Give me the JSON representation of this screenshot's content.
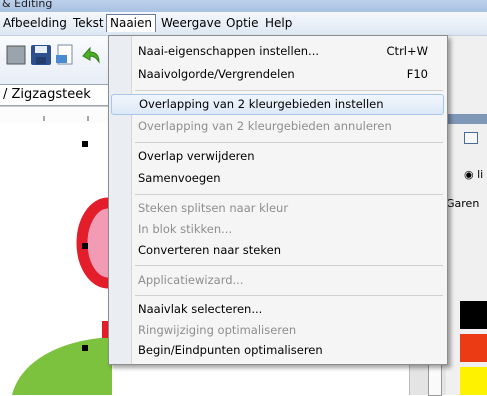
{
  "window": {
    "title": "& Editing"
  },
  "menubar": {
    "items": [
      "Afbeelding",
      "Tekst",
      "Naaien",
      "Weergave",
      "Optie",
      "Help"
    ],
    "active": "Naaien"
  },
  "stitch_type": {
    "value": "Zigzagsteek",
    "prefix": "/"
  },
  "right_panel": {
    "radio_text": "li",
    "label": "Garen"
  },
  "dropdown": {
    "items": [
      {
        "label": "Naai-eigenschappen instellen...",
        "shortcut": "Ctrl+W",
        "enabled": true
      },
      {
        "label": "Naaivolgorde/Vergrendelen",
        "shortcut": "F10",
        "enabled": true
      },
      {
        "label": "Overlapping van 2 kleurgebieden instellen",
        "shortcut": "",
        "enabled": true,
        "highlighted": true
      },
      {
        "label": "Overlapping van 2 kleurgebieden annuleren",
        "shortcut": "",
        "enabled": false
      },
      {
        "label": "Overlap verwijderen",
        "shortcut": "",
        "enabled": true
      },
      {
        "label": "Samenvoegen",
        "shortcut": "",
        "enabled": true
      },
      {
        "label": "Steken splitsen naar kleur",
        "shortcut": "",
        "enabled": false
      },
      {
        "label": "In blok stikken...",
        "shortcut": "",
        "enabled": false
      },
      {
        "label": "Converteren naar steken",
        "shortcut": "",
        "enabled": true
      },
      {
        "label": "Applicatiewizard...",
        "shortcut": "",
        "enabled": false
      },
      {
        "label": "Naaivlak selecteren...",
        "shortcut": "",
        "enabled": true
      },
      {
        "label": "Ringwijziging optimaliseren",
        "shortcut": "",
        "enabled": false
      },
      {
        "label": "Begin/Eindpunten optimaliseren",
        "shortcut": "",
        "enabled": true
      }
    ]
  },
  "colors": {
    "flower_red": "#e41d2a",
    "flower_pink": "#f29bb5",
    "leaf_green": "#7dc23f",
    "swatch_black": "#000000",
    "swatch_red": "#ea3b15",
    "swatch_yellow": "#fff200"
  }
}
